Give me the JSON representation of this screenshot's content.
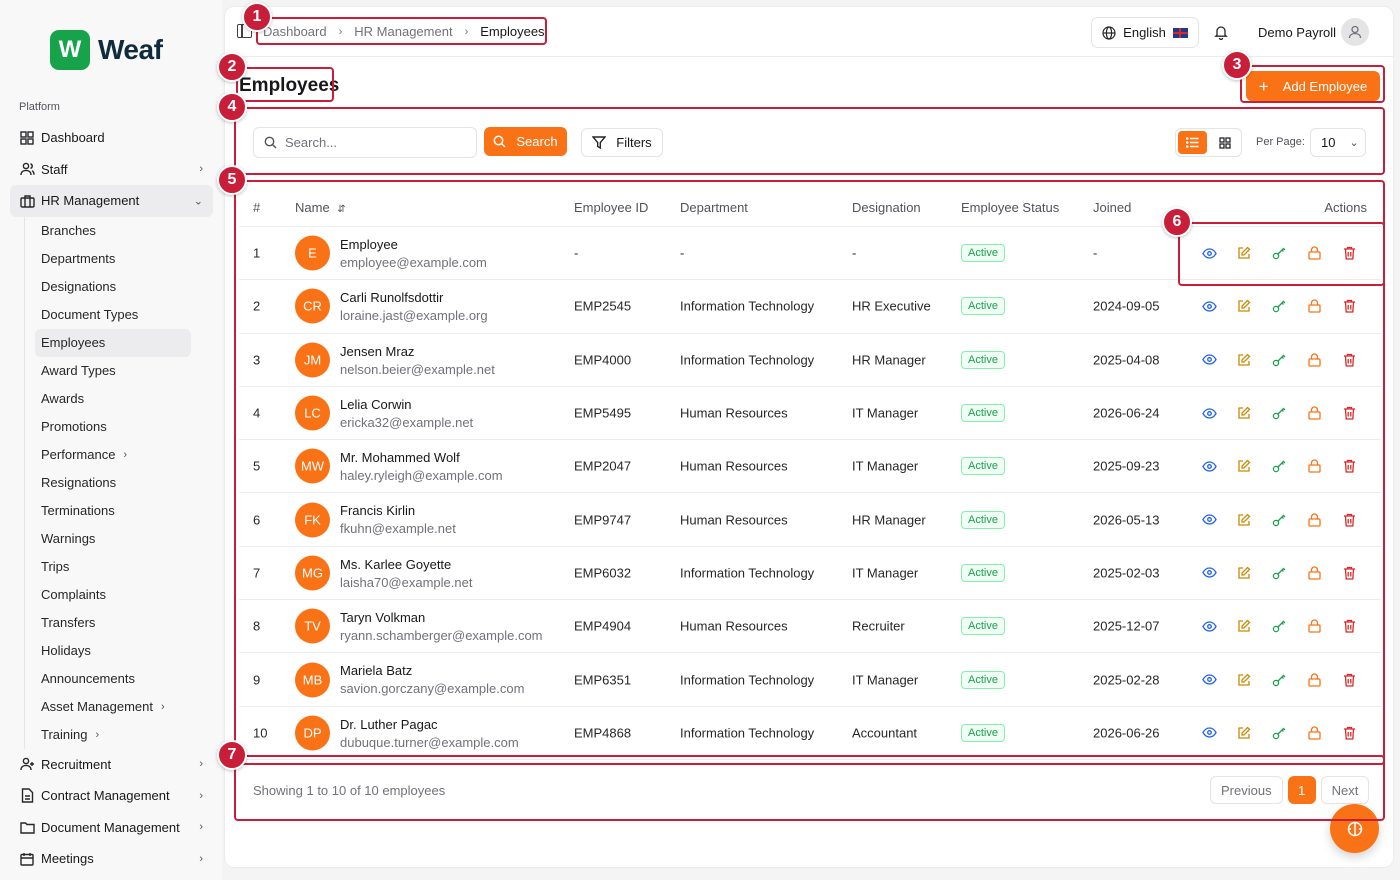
{
  "brand": {
    "mark": "W",
    "name": "Weaf"
  },
  "sidebar": {
    "section_label": "Platform",
    "top_items": [
      {
        "label": "Dashboard",
        "icon": "dashboard-icon"
      },
      {
        "label": "Staff",
        "icon": "users-icon"
      },
      {
        "label": "HR Management",
        "icon": "briefcase-icon"
      }
    ],
    "hr_sub_items": [
      {
        "label": "Branches"
      },
      {
        "label": "Departments"
      },
      {
        "label": "Designations"
      },
      {
        "label": "Document Types"
      },
      {
        "label": "Employees"
      },
      {
        "label": "Award Types"
      },
      {
        "label": "Awards"
      },
      {
        "label": "Promotions"
      },
      {
        "label": "Performance"
      },
      {
        "label": "Resignations"
      },
      {
        "label": "Terminations"
      },
      {
        "label": "Warnings"
      },
      {
        "label": "Trips"
      },
      {
        "label": "Complaints"
      },
      {
        "label": "Transfers"
      },
      {
        "label": "Holidays"
      },
      {
        "label": "Announcements"
      },
      {
        "label": "Asset Management"
      },
      {
        "label": "Training"
      }
    ],
    "bottom_items": [
      {
        "label": "Recruitment",
        "icon": "recruit-icon"
      },
      {
        "label": "Contract Management",
        "icon": "contract-icon"
      },
      {
        "label": "Document Management",
        "icon": "folder-icon"
      },
      {
        "label": "Meetings",
        "icon": "calendar-icon"
      }
    ]
  },
  "topbar": {
    "breadcrumb": [
      "Dashboard",
      "HR Management",
      "Employees"
    ],
    "language": "English",
    "user_name": "Demo Payroll"
  },
  "page": {
    "title": "Employees",
    "add_button": "Add Employee"
  },
  "toolbar": {
    "search_placeholder": "Search...",
    "search_button": "Search",
    "filters_button": "Filters",
    "per_page_label": "Per Page:",
    "per_page_value": "10"
  },
  "table": {
    "headers": {
      "num": "#",
      "name": "Name",
      "employee_id": "Employee ID",
      "department": "Department",
      "designation": "Designation",
      "status": "Employee Status",
      "joined": "Joined",
      "actions": "Actions"
    },
    "rows": [
      {
        "num": "1",
        "initials": "E",
        "name": "Employee",
        "email": "employee@example.com",
        "employee_id": "-",
        "department": "-",
        "designation": "-",
        "status": "Active",
        "joined": "-"
      },
      {
        "num": "2",
        "initials": "CR",
        "name": "Carli Runolfsdottir",
        "email": "loraine.jast@example.org",
        "employee_id": "EMP2545",
        "department": "Information Technology",
        "designation": "HR Executive",
        "status": "Active",
        "joined": "2024-09-05"
      },
      {
        "num": "3",
        "initials": "JM",
        "name": "Jensen Mraz",
        "email": "nelson.beier@example.net",
        "employee_id": "EMP4000",
        "department": "Information Technology",
        "designation": "HR Manager",
        "status": "Active",
        "joined": "2025-04-08"
      },
      {
        "num": "4",
        "initials": "LC",
        "name": "Lelia Corwin",
        "email": "ericka32@example.net",
        "employee_id": "EMP5495",
        "department": "Human Resources",
        "designation": "IT Manager",
        "status": "Active",
        "joined": "2026-06-24"
      },
      {
        "num": "5",
        "initials": "MW",
        "name": "Mr. Mohammed Wolf",
        "email": "haley.ryleigh@example.com",
        "employee_id": "EMP2047",
        "department": "Human Resources",
        "designation": "IT Manager",
        "status": "Active",
        "joined": "2025-09-23"
      },
      {
        "num": "6",
        "initials": "FK",
        "name": "Francis Kirlin",
        "email": "fkuhn@example.net",
        "employee_id": "EMP9747",
        "department": "Human Resources",
        "designation": "HR Manager",
        "status": "Active",
        "joined": "2026-05-13"
      },
      {
        "num": "7",
        "initials": "MG",
        "name": "Ms. Karlee Goyette",
        "email": "laisha70@example.net",
        "employee_id": "EMP6032",
        "department": "Information Technology",
        "designation": "IT Manager",
        "status": "Active",
        "joined": "2025-02-03"
      },
      {
        "num": "8",
        "initials": "TV",
        "name": "Taryn Volkman",
        "email": "ryann.schamberger@example.com",
        "employee_id": "EMP4904",
        "department": "Human Resources",
        "designation": "Recruiter",
        "status": "Active",
        "joined": "2025-12-07"
      },
      {
        "num": "9",
        "initials": "MB",
        "name": "Mariela Batz",
        "email": "savion.gorczany@example.com",
        "employee_id": "EMP6351",
        "department": "Information Technology",
        "designation": "IT Manager",
        "status": "Active",
        "joined": "2025-02-28"
      },
      {
        "num": "10",
        "initials": "DP",
        "name": "Dr. Luther Pagac",
        "email": "dubuque.turner@example.com",
        "employee_id": "EMP4868",
        "department": "Information Technology",
        "designation": "Accountant",
        "status": "Active",
        "joined": "2026-06-26"
      }
    ]
  },
  "footer": {
    "showing_text": "Showing 1 to 10 of 10 employees",
    "previous": "Previous",
    "current_page": "1",
    "next": "Next"
  },
  "annotations": [
    "1",
    "2",
    "3",
    "4",
    "5",
    "6",
    "7"
  ],
  "colors": {
    "accent": "#f97316",
    "annotation": "#c81e3a",
    "status_active": "#16a34a",
    "action_view": "#2563eb",
    "action_edit": "#ca8a04",
    "action_key": "#16a34a",
    "action_lock": "#f97316",
    "action_delete": "#dc2626"
  }
}
